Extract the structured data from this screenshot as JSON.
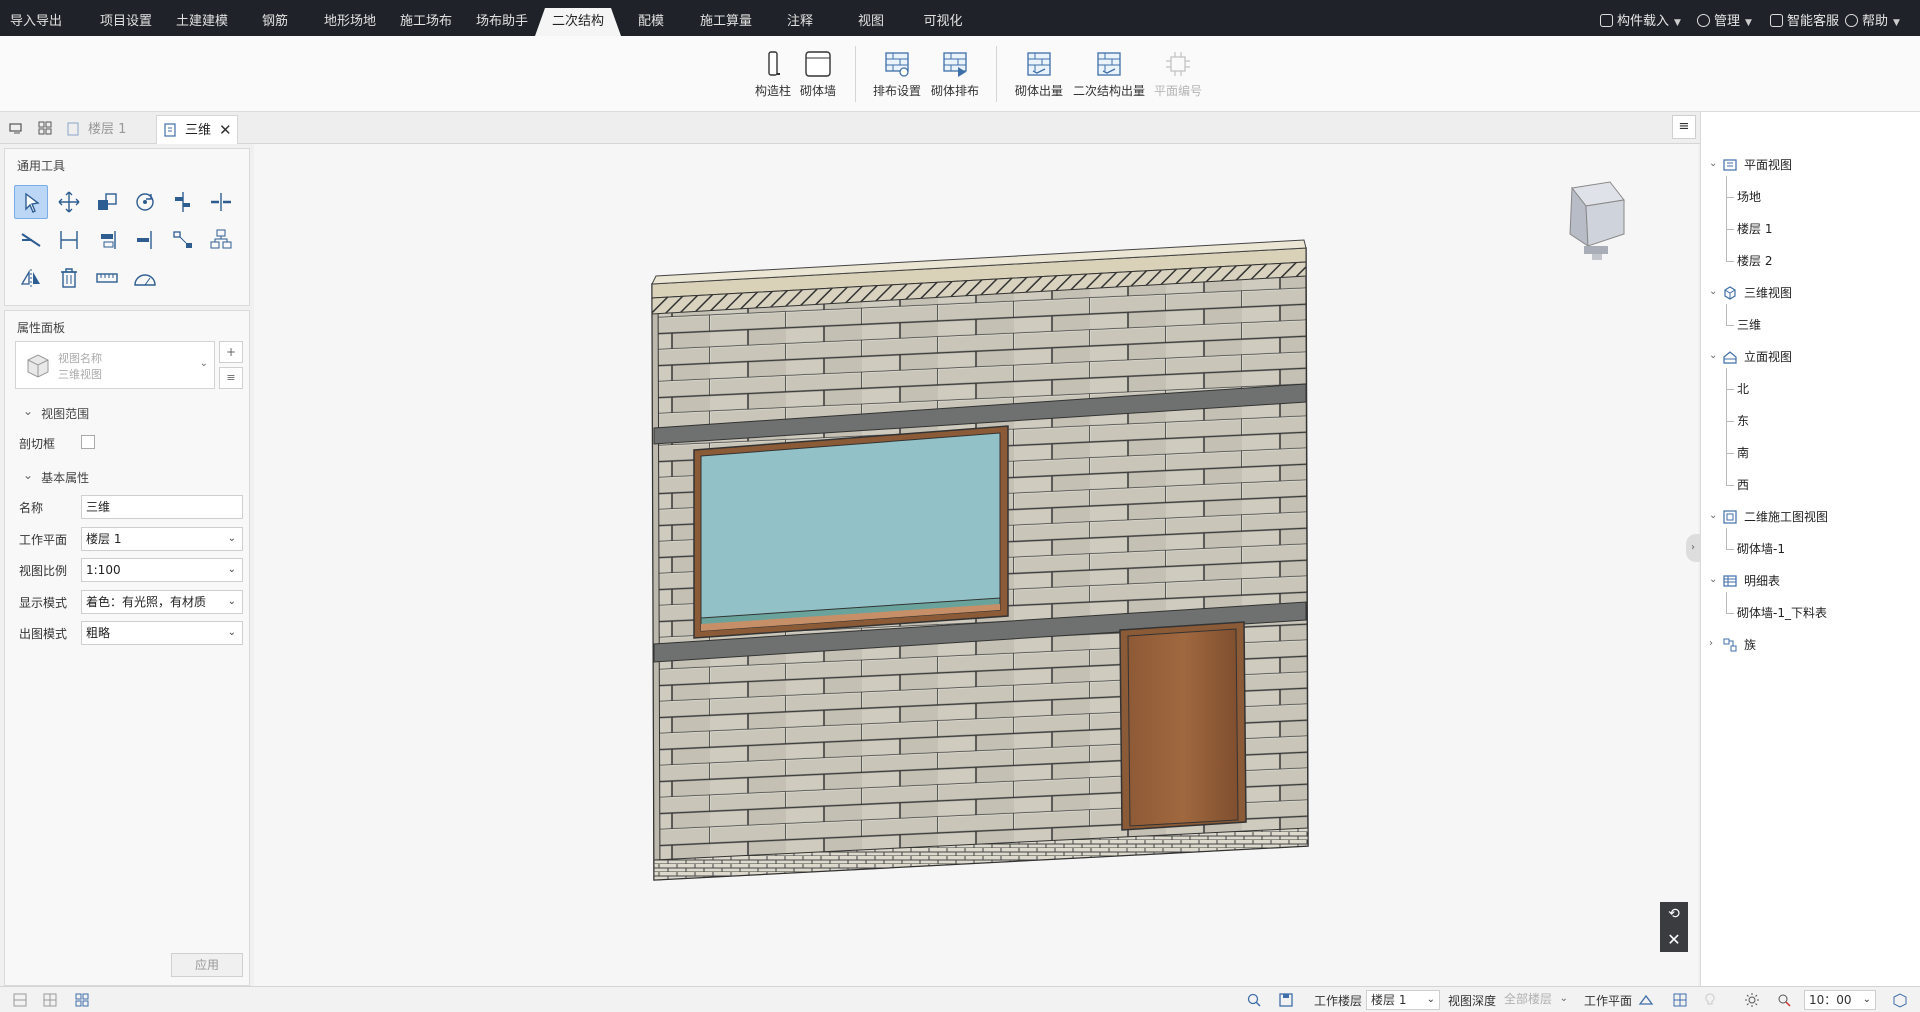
{
  "menu": {
    "tabs": [
      "导入导出",
      "项目设置",
      "土建建模",
      "钢筋",
      "地形场地",
      "施工场布",
      "场布助手",
      "二次结构",
      "配模",
      "施工算量",
      "注释",
      "视图",
      "可视化"
    ],
    "active": "二次结构",
    "right": {
      "component": "构件载入",
      "manage": "管理",
      "service": "智能客服",
      "help": "帮助"
    }
  },
  "ribbon": {
    "buttons": [
      {
        "label": "构造柱",
        "icon": "column-icon",
        "enabled": true
      },
      {
        "label": "砌体墙",
        "icon": "masonry-wall-icon",
        "enabled": true
      },
      {
        "label": "排布设置",
        "icon": "layout-settings-icon",
        "enabled": true
      },
      {
        "label": "砌体排布",
        "icon": "masonry-layout-icon",
        "enabled": true
      },
      {
        "label": "砌体出量",
        "icon": "masonry-quantity-icon",
        "enabled": true
      },
      {
        "label": "二次结构出量",
        "icon": "secondary-quantity-icon",
        "enabled": true
      },
      {
        "label": "平面编号",
        "icon": "plan-number-icon",
        "enabled": false
      }
    ]
  },
  "doc_tabs": [
    {
      "label": "楼层 1",
      "active": false
    },
    {
      "label": "三维",
      "active": true
    }
  ],
  "tools_panel": {
    "title": "通用工具"
  },
  "properties": {
    "title": "属性面板",
    "view_type": {
      "line1": "视图名称",
      "line2": "三维视图"
    },
    "section_view_range": "视图范围",
    "crop_box_label": "剖切框",
    "section_basic": "基本属性",
    "fields": [
      {
        "label": "名称",
        "value": "三维",
        "dropdown": false
      },
      {
        "label": "工作平面",
        "value": "楼层 1",
        "dropdown": true
      },
      {
        "label": "视图比例",
        "value": "1:100",
        "dropdown": true
      },
      {
        "label": "显示模式",
        "value": "着色：有光照，有材质",
        "dropdown": true
      },
      {
        "label": "出图模式",
        "value": "粗略",
        "dropdown": true
      }
    ],
    "apply_label": "应用"
  },
  "browser": {
    "groups": [
      {
        "label": "平面视图",
        "icon": "plan-view-icon",
        "expanded": true,
        "children": [
          "场地",
          "楼层 1",
          "楼层 2"
        ]
      },
      {
        "label": "三维视图",
        "icon": "3d-view-icon",
        "expanded": true,
        "children": [
          "三维"
        ]
      },
      {
        "label": "立面视图",
        "icon": "elevation-view-icon",
        "expanded": true,
        "children": [
          "北",
          "东",
          "南",
          "西"
        ]
      },
      {
        "label": "二维施工图视图",
        "icon": "2d-drawing-icon",
        "expanded": true,
        "children": [
          "砌体墙-1"
        ]
      },
      {
        "label": "明细表",
        "icon": "schedule-icon",
        "expanded": true,
        "children": [
          "砌体墙-1_下料表"
        ]
      },
      {
        "label": "族",
        "icon": "family-icon",
        "expanded": false,
        "children": []
      }
    ]
  },
  "status": {
    "work_floor_label": "工作楼层",
    "work_floor_value": "楼层 1",
    "view_depth_label": "视图深度",
    "view_depth_value": "全部楼层",
    "work_plane_label": "工作平面",
    "time_value": "10：00"
  },
  "colors": {
    "menubar": "#1f2329",
    "selected_tool": "#bcd7f6",
    "window_glass": "#92c1c7",
    "door": "#8b5a36"
  }
}
